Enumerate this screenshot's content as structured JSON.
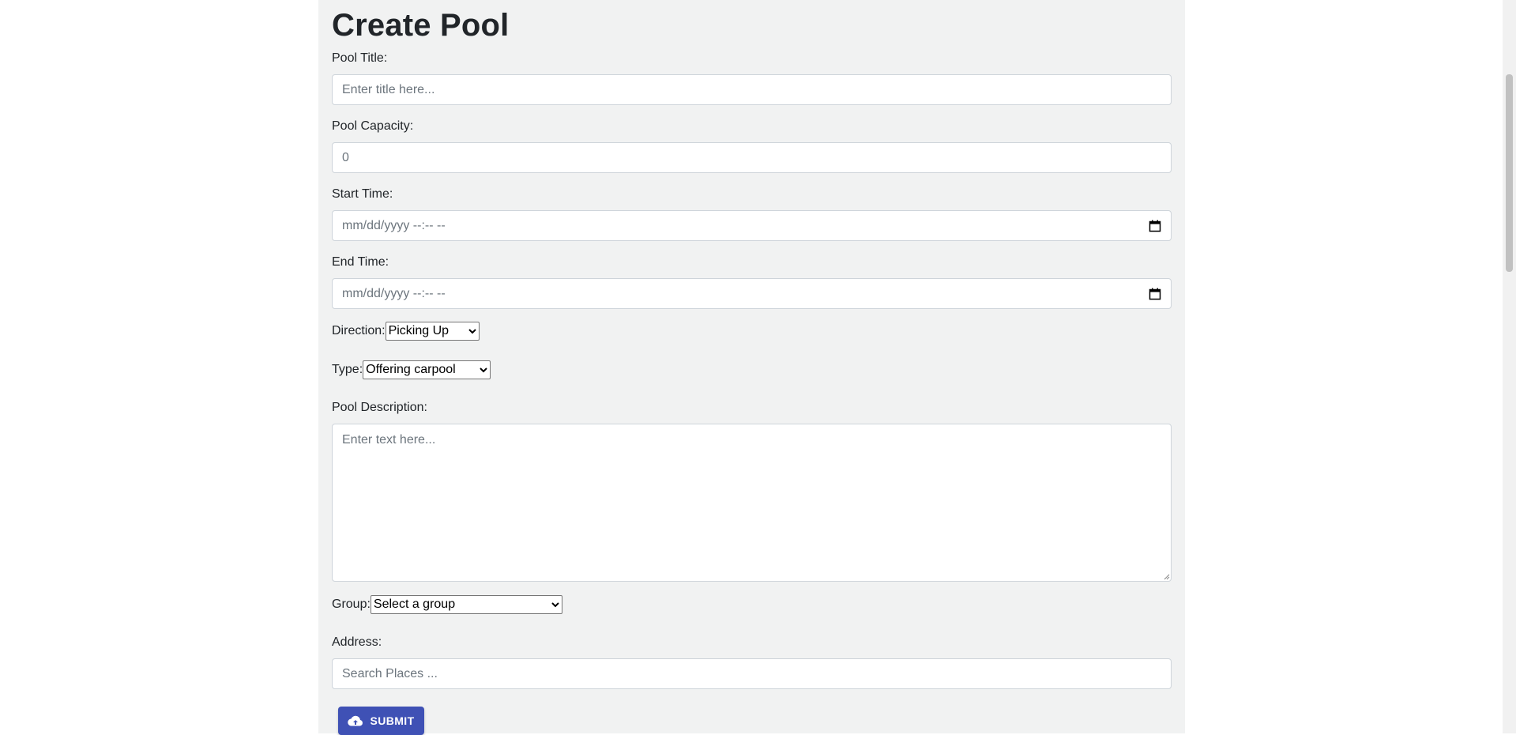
{
  "page": {
    "title": "Create Pool"
  },
  "form": {
    "title_label": "Pool Title:",
    "title_placeholder": "Enter title here...",
    "capacity_label": "Pool Capacity:",
    "capacity_placeholder": "0",
    "start_label": "Start Time:",
    "start_value": "mm/dd/yyyy --:-- --",
    "end_label": "End Time:",
    "end_value": "mm/dd/yyyy --:-- --",
    "direction_label": "Direction:",
    "direction_value": "Picking Up",
    "type_label": "Type:",
    "type_value": "Offering carpool",
    "description_label": "Pool Description:",
    "description_placeholder": "Enter text here...",
    "group_label": "Group:",
    "group_value": "Select a group",
    "address_label": "Address:",
    "address_placeholder": "Search Places ...",
    "submit_label": "SUBMIT"
  },
  "colors": {
    "panel_bg": "#f1f2f2",
    "submit_bg": "#3f51b5"
  },
  "icons": {
    "calendar": "calendar-icon",
    "chevron": "chevron-down-icon",
    "upload": "cloud-upload-icon"
  }
}
